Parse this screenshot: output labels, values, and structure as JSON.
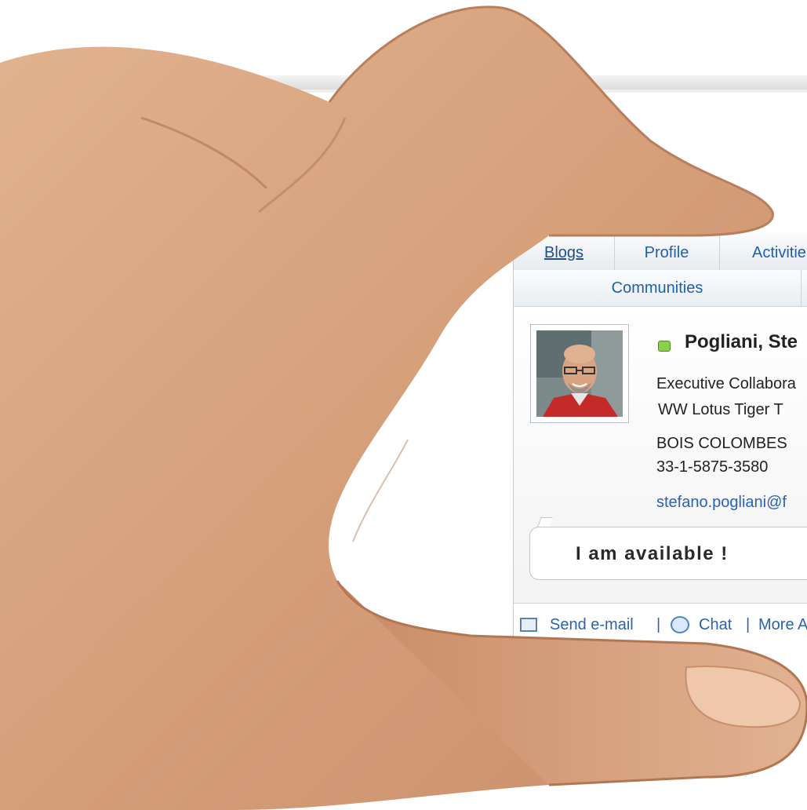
{
  "card": {
    "tabs": {
      "blogs": "Blogs",
      "profile": "Profile",
      "activities": "Activitie",
      "communities": "Communities"
    },
    "person": {
      "name": "Pogliani, Ste",
      "title": "Executive Collabora",
      "department": "WW Lotus Tiger  T",
      "city": "BOIS COLOMBES",
      "phone": "33-1-5875-3580",
      "email": "stefano.pogliani@f",
      "presence_color": "#8bd04b"
    },
    "status_message": "I am available !",
    "footer": {
      "send_email": "Send e-mail",
      "separator": "|",
      "chat": "Chat",
      "more": "More A"
    }
  },
  "colors": {
    "link": "#1f5fa8",
    "skin": "#d9a47d"
  },
  "icons": [
    "presence-icon",
    "email-icon",
    "chat-icon"
  ]
}
